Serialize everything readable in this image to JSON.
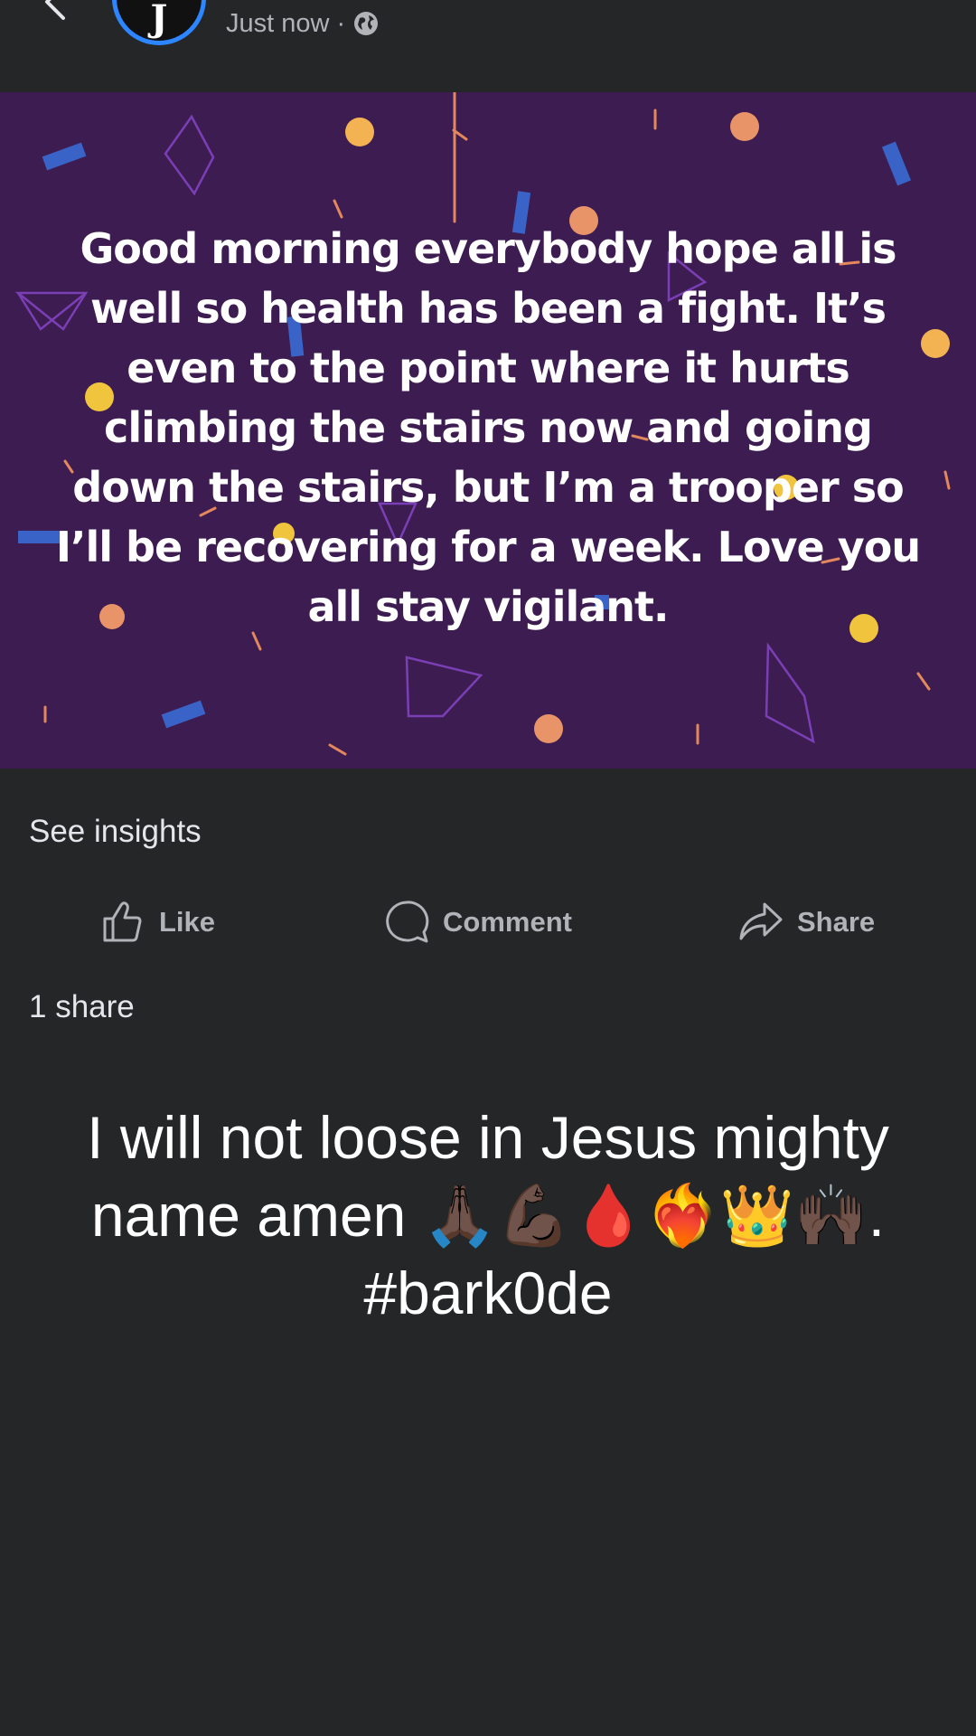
{
  "header": {
    "timestamp": "Just now",
    "separator": "·",
    "avatar_letter": "J",
    "audience_icon": "globe-icon",
    "back_icon": "chevron-left-icon",
    "more_icon": "more-horizontal-icon"
  },
  "post": {
    "text": "Good morning everybody hope all is well so health has been a fight. It’s even to the point where it hurts climbing the stairs now and going down the stairs, but I’m a trooper so I’ll be recovering for a week. Love you all stay vigilant.",
    "background_color": "#3d1c52"
  },
  "insights_label": "See insights",
  "actions": {
    "like": {
      "label": "Like",
      "icon": "thumbs-up-icon"
    },
    "comment": {
      "label": "Comment",
      "icon": "comment-icon"
    },
    "share": {
      "label": "Share",
      "icon": "share-icon"
    }
  },
  "share_count": "1 share",
  "caption": "I will not loose in Jesus mighty name amen 🙏🏿💪🏿🩸❤️‍🔥👑🙌🏿. #bark0de",
  "colors": {
    "background": "#242628",
    "accent": "#2d86ff",
    "secondary_text": "#b0b3b8",
    "primary_text": "#e4e6eb"
  }
}
